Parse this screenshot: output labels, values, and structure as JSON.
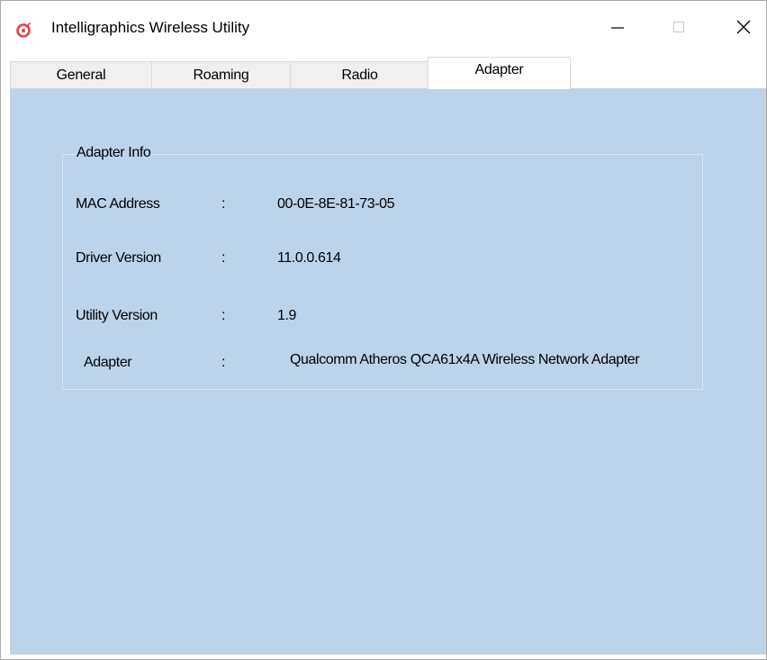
{
  "window": {
    "title": "Intelligraphics Wireless Utility",
    "icon": "app-target-icon",
    "controls": [
      "minimize-icon",
      "maximize-icon",
      "close-icon"
    ]
  },
  "tabs": [
    {
      "label": "General",
      "active": false
    },
    {
      "label": "Roaming",
      "active": false
    },
    {
      "label": "Radio",
      "active": false
    },
    {
      "label": "Adapter",
      "active": true
    }
  ],
  "adapter_info": {
    "legend": "Adapter Info",
    "rows": [
      {
        "label": "MAC Address",
        "separator": ":",
        "value": "00-0E-8E-81-73-05"
      },
      {
        "label": "Driver Version",
        "separator": ":",
        "value": "11.0.0.614"
      },
      {
        "label": "Utility Version",
        "separator": ":",
        "value": "1.9"
      },
      {
        "label": "Adapter",
        "separator": ":",
        "value": "Qualcomm Atheros QCA61x4A Wireless Network Adapter"
      }
    ]
  },
  "colors": {
    "panel_background": "#bcd3ea",
    "icon_red": "#e8423b"
  }
}
